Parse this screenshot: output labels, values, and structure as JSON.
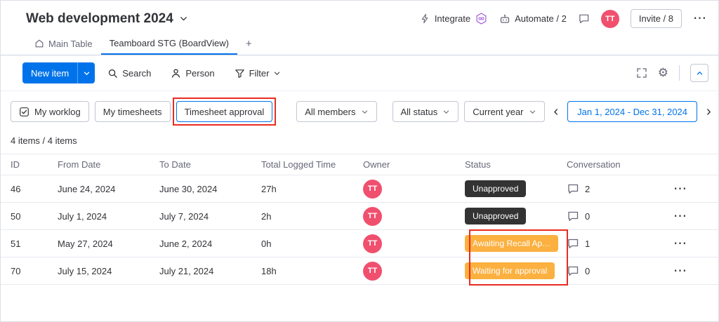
{
  "colors": {
    "accent": "#0073ea",
    "avatar_bg": "#f0506e",
    "badge_dark": "#333333",
    "badge_orange": "#fbb040",
    "annotation": "#e92c21",
    "icon_purple": "#a25ddc"
  },
  "icons": {
    "gear_glyph": "⚙",
    "more_glyph": "⋯",
    "prev_glyph": "‹",
    "next_glyph": "›",
    "plus_glyph": "+"
  },
  "header": {
    "title": "Web development 2024",
    "integrate_label": "Integrate",
    "automate_label": "Automate / 2",
    "invite_label": "Invite / 8",
    "avatar_initials": "TT"
  },
  "tabs": {
    "main_table_label": "Main Table",
    "board_tab_label": "Teamboard STG (BoardView)"
  },
  "toolbar": {
    "new_item_label": "New item",
    "search_label": "Search",
    "person_label": "Person",
    "filter_label": "Filter"
  },
  "filters": {
    "my_worklog_label": "My worklog",
    "my_timesheets_label": "My timesheets",
    "timesheet_approval_label": "Timesheet approval",
    "members_value": "All members",
    "status_value": "All status",
    "period_value": "Current year",
    "date_range_value": "Jan 1, 2024 - Dec 31, 2024"
  },
  "items_count": "4 items / 4 items",
  "table": {
    "columns": [
      "ID",
      "From Date",
      "To Date",
      "Total Logged Time",
      "Owner",
      "Status",
      "Conversation"
    ],
    "rows": [
      {
        "id": "46",
        "from_date": "June 24, 2024",
        "to_date": "June 30, 2024",
        "total_logged_time": "27h",
        "owner_initials": "TT",
        "status": "Unapproved",
        "status_color": "dark",
        "conversation_count": "2"
      },
      {
        "id": "50",
        "from_date": "July 1, 2024",
        "to_date": "July 7, 2024",
        "total_logged_time": "2h",
        "owner_initials": "TT",
        "status": "Unapproved",
        "status_color": "dark",
        "conversation_count": "0"
      },
      {
        "id": "51",
        "from_date": "May 27, 2024",
        "to_date": "June 2, 2024",
        "total_logged_time": "0h",
        "owner_initials": "TT",
        "status": "Awaiting Recall Ap…",
        "status_color": "orange",
        "conversation_count": "1"
      },
      {
        "id": "70",
        "from_date": "July 15, 2024",
        "to_date": "July 21, 2024",
        "total_logged_time": "18h",
        "owner_initials": "TT",
        "status": "Waiting for approval",
        "status_color": "orange",
        "conversation_count": "0"
      }
    ]
  }
}
